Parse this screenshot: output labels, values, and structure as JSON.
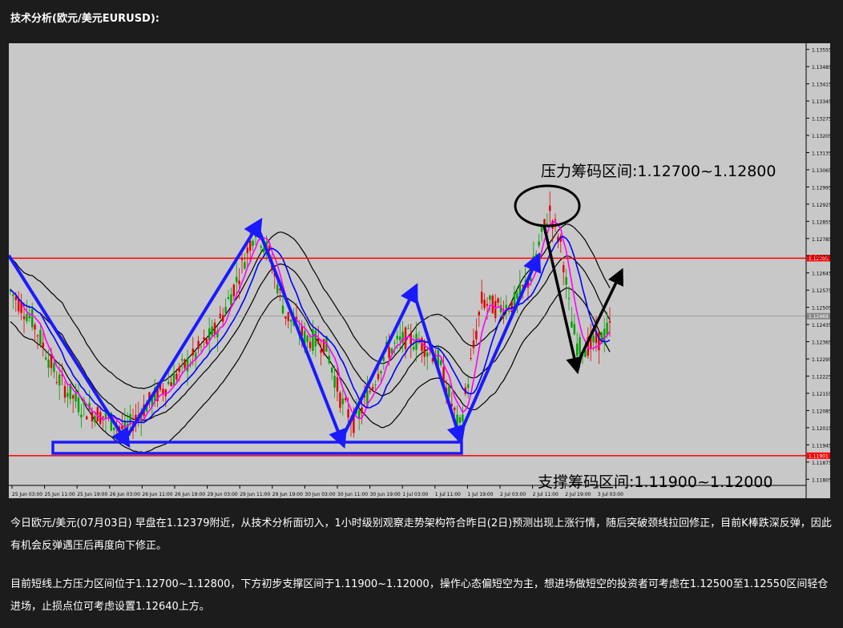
{
  "header": {
    "title": "技术分析(欧元/美元EURUSD):"
  },
  "chart_data": {
    "type": "candlestick",
    "title": "",
    "annotations": {
      "resistance": "压力筹码区间:1.12700~1.12800",
      "support": "支撑筹码区间:1.11900~1.12000"
    },
    "y_ticks": [
      "1.13555",
      "1.13485",
      "1.13415",
      "1.13345",
      "1.13275",
      "1.13205",
      "1.13135",
      "1.13065",
      "1.12995",
      "1.12925",
      "1.12855",
      "1.12785",
      "1.12715",
      "1.12645",
      "1.12575",
      "1.12505",
      "1.12435",
      "1.12365",
      "1.12295",
      "1.12225",
      "1.12155",
      "1.12085",
      "1.12015",
      "1.11945",
      "1.11875",
      "1.11805"
    ],
    "x_ticks": [
      "25 Jun 03:00",
      "25 Jun 11:00",
      "25 Jun 19:00",
      "26 Jun 03:00",
      "26 Jun 11:00",
      "26 Jun 19:00",
      "29 Jun 03:00",
      "29 Jun 11:00",
      "29 Jun 19:00",
      "30 Jun 03:00",
      "30 Jun 11:00",
      "30 Jun 19:00",
      "1 Jul 03:00",
      "1 Jul 11:00",
      "1 Jul 19:00",
      "2 Jul 03:00",
      "2 Jul 11:00",
      "2 Jul 19:00",
      "3 Jul 03:00"
    ],
    "ylim": [
      1.1178,
      1.1358
    ],
    "resistance_level": 1.12705,
    "support_level": 1.11901,
    "current_price": 1.12469,
    "price_labels": {
      "resistance": "1.12705",
      "support": "1.11901",
      "current": "1.12469"
    },
    "colors": {
      "background": "#c8c8c8",
      "bull": "#00a000",
      "bear": "#e00000",
      "level_line": "#ff0000",
      "arrows": "#1a1aff",
      "ma_fast": "#ff00ff",
      "ma_slow": "#0000ff",
      "bands": "#000000"
    }
  },
  "body": {
    "paragraph1": "今日欧元/美元(07月03日) 早盘在1.12379附近，从技术分析面切入，1小时级别观察走势架构符合昨日(2日)预测出现上涨行情，随后突破颈线拉回修正，目前K棒跌深反弹，因此有机会反弹遇压后再度向下修正。",
    "paragraph2": "目前短线上方压力区间位于1.12700~1.12800，下方初步支撑区间于1.11900~1.12000，操作心态偏短空为主，想进场做短空的投资者可考虑在1.12500至1.12550区间轻仓进场，止损点位可考虑设置1.12640上方。"
  }
}
